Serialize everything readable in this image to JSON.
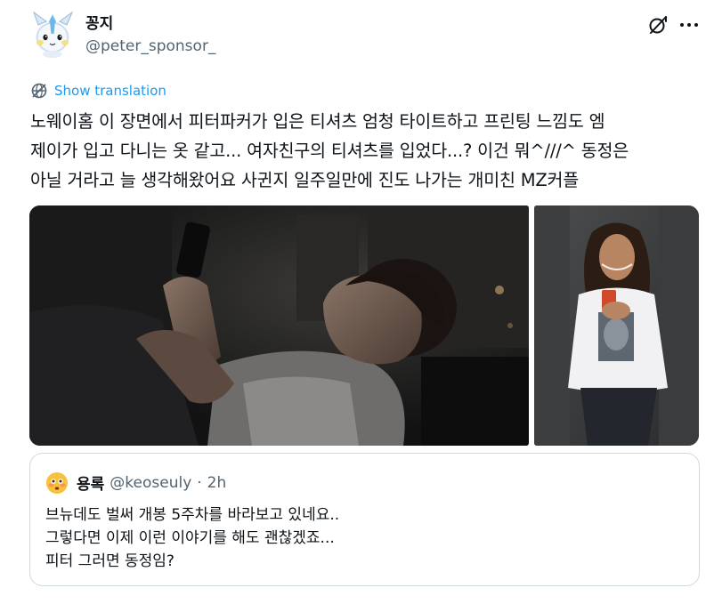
{
  "author": {
    "display_name": "꽁지",
    "handle": "@peter_sponsor_"
  },
  "actions": {
    "grok_icon": "grok-icon",
    "more_icon": "more-horizontal-icon"
  },
  "translate": {
    "label": "Show translation",
    "icon": "translate-icon"
  },
  "tweet": {
    "lines": [
      "노웨이홈 이 장면에서 피터파커가 입은 티셔츠 엄청 타이트하고 프린팅 느낌도 엠",
      "제이가 입고 다니는 옷 같고... 여자친구의 티셔츠를 입었다...? 이건 뭐^///^ 동정은",
      "아닐 거라고 늘 생각해왔어요 사귄지 일주일만에 진도 나가는 개미친 MZ커플"
    ]
  },
  "media": {
    "count": 2
  },
  "quote": {
    "avatar_icon": "flushed-face-icon",
    "name": "용록",
    "handle": "@keoseuly",
    "dot": "·",
    "time": "2h",
    "lines": [
      "브뉴데도 벌써 개봉 5주차를 바라보고 있네요..",
      "그렇다면 이제 이런 이야기를 해도 괜찮겠죠...",
      "피터 그러면 동정임?"
    ]
  },
  "colors": {
    "link": "#1d9bf0",
    "secondary_text": "#536471",
    "border": "#cfd9de"
  }
}
